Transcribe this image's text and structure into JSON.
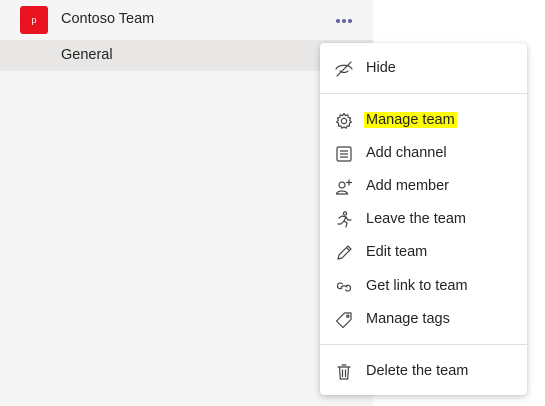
{
  "team": {
    "avatar_letter": "p",
    "avatar_color": "#e8131e",
    "name": "Contoso Team",
    "more_icon": "more-horizontal-icon"
  },
  "channel": {
    "name": "General"
  },
  "menu": {
    "items": [
      {
        "label": "Hide",
        "icon": "eye-off-icon"
      },
      {
        "label": "Manage team",
        "icon": "gear-icon",
        "highlighted": true
      },
      {
        "label": "Add channel",
        "icon": "channel-list-icon"
      },
      {
        "label": "Add member",
        "icon": "person-add-icon"
      },
      {
        "label": "Leave the team",
        "icon": "person-running-icon"
      },
      {
        "label": "Edit team",
        "icon": "pencil-icon"
      },
      {
        "label": "Get link to team",
        "icon": "link-icon"
      },
      {
        "label": "Manage tags",
        "icon": "tag-icon"
      },
      {
        "label": "Delete the team",
        "icon": "trash-icon"
      }
    ]
  },
  "colors": {
    "highlight": "#ffff00",
    "accent": "#6264a7"
  }
}
